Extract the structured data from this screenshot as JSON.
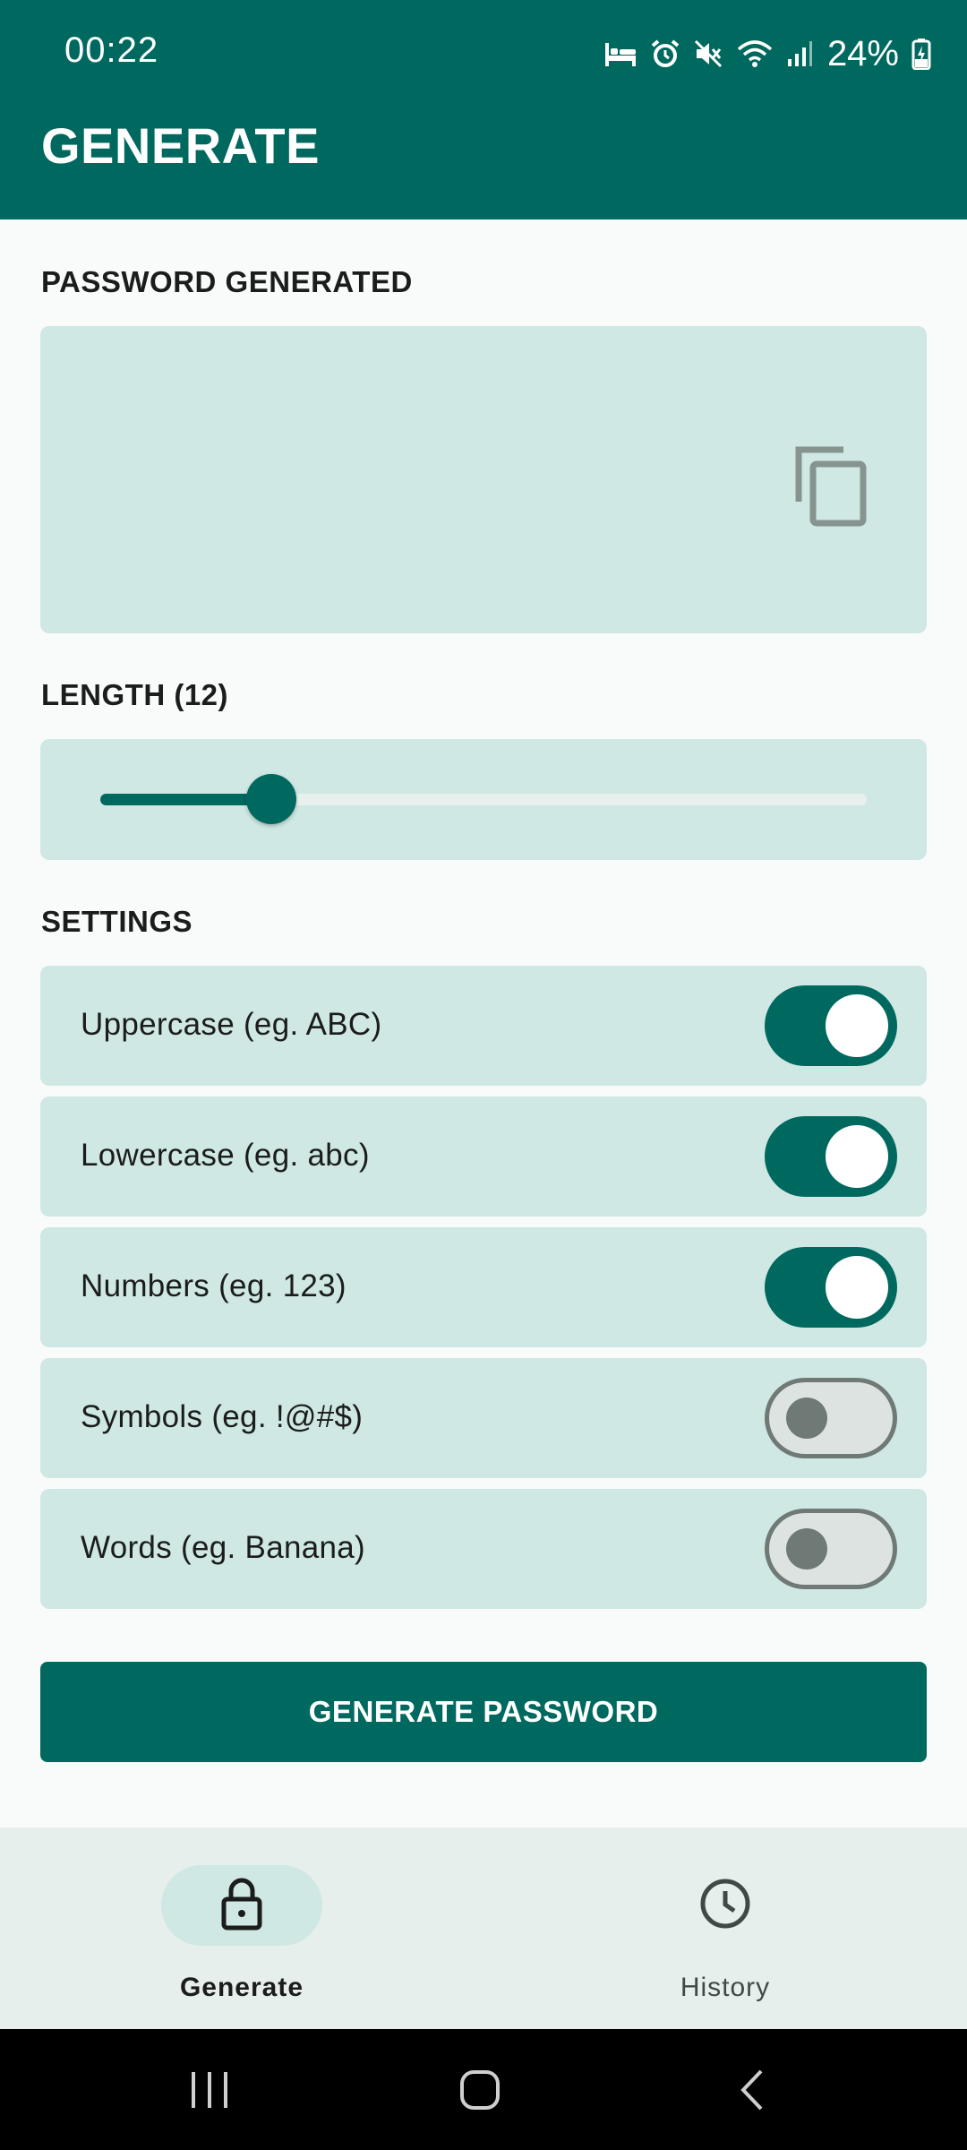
{
  "status_bar": {
    "time": "00:22",
    "battery": "24%",
    "icons": [
      "bed-icon",
      "alarm-icon",
      "mute-icon",
      "wifi-icon",
      "signal-icon",
      "battery-charging-icon"
    ]
  },
  "app_bar": {
    "title": "GENERATE"
  },
  "password": {
    "section_label": "PASSWORD GENERATED",
    "value": "",
    "copy_icon": "copy-icon"
  },
  "length": {
    "section_label": "LENGTH (12)",
    "slider_fraction": 0.223
  },
  "settings": {
    "section_label": "SETTINGS",
    "items": [
      {
        "label": "Uppercase (eg. ABC)",
        "enabled": true
      },
      {
        "label": "Lowercase (eg. abc)",
        "enabled": true
      },
      {
        "label": "Numbers (eg. 123)",
        "enabled": true
      },
      {
        "label": "Symbols (eg. !@#$)",
        "enabled": false
      },
      {
        "label": "Words (eg. Banana)",
        "enabled": false
      }
    ]
  },
  "generate_button": {
    "label": "GENERATE PASSWORD"
  },
  "bottom_nav": {
    "items": [
      {
        "label": "Generate",
        "icon": "lock-icon",
        "active": true
      },
      {
        "label": "History",
        "icon": "clock-icon",
        "active": false
      }
    ]
  },
  "colors": {
    "primary": "#00695f",
    "container": "#cfe8e3",
    "background": "#f8fbfa",
    "nav_background": "#e6efec"
  }
}
